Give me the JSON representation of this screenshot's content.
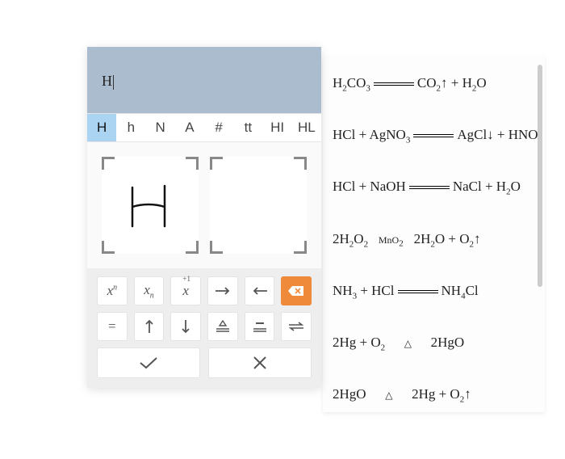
{
  "entry": {
    "text": "H"
  },
  "candidates": {
    "items": [
      {
        "label": "H",
        "active": true
      },
      {
        "label": "h",
        "active": false
      },
      {
        "label": "N",
        "active": false
      },
      {
        "label": "A",
        "active": false
      },
      {
        "label": "#",
        "active": false
      },
      {
        "label": "tt",
        "active": false
      },
      {
        "label": "HI",
        "active": false
      },
      {
        "label": "HL",
        "active": false
      }
    ]
  },
  "keypad": {
    "row1": [
      {
        "name": "superscript",
        "label": "xⁿ"
      },
      {
        "name": "subscript",
        "label": "xₙ"
      },
      {
        "name": "oxidation",
        "label": "⁺¹x"
      },
      {
        "name": "arrow-right",
        "label": "→"
      },
      {
        "name": "arrow-left",
        "label": "←"
      },
      {
        "name": "backspace",
        "label": "⌫"
      }
    ],
    "row2": [
      {
        "name": "equals",
        "label": "="
      },
      {
        "name": "gas-up",
        "label": "↑"
      },
      {
        "name": "precipitate-down",
        "label": "↓"
      },
      {
        "name": "cond-triangle",
        "label": "△═"
      },
      {
        "name": "cond-bar",
        "label": "▭═"
      },
      {
        "name": "reversible",
        "label": "⇌"
      }
    ]
  },
  "actions": {
    "confirm": "✓",
    "cancel": "✕"
  },
  "equations": {
    "items": [
      {
        "text": "H₂CO₃ ⟶ CO₂↑ + H₂O"
      },
      {
        "text": "HCl + AgNO₃ ⟶ AgCl↓ + HNO"
      },
      {
        "text": "HCl + NaOH ⟶ NaCl + H₂O"
      },
      {
        "text": "2H₂O₂ —(MnO₂)→ 2H₂O + O₂↑"
      },
      {
        "text": "NH₃ + HCl ⟶ NH₄Cl"
      },
      {
        "text": "2Hg + O₂ —(△)→ 2HgO"
      },
      {
        "text": "2HgO —(△)→ 2Hg + O₂↑"
      }
    ]
  },
  "icons": {
    "backspace": "backspace-icon",
    "confirm": "check-icon",
    "cancel": "cross-icon"
  },
  "colors": {
    "entry_bg": "#aabccd",
    "candidate_active": "#abd3f2",
    "backspace": "#ef8a3b"
  }
}
